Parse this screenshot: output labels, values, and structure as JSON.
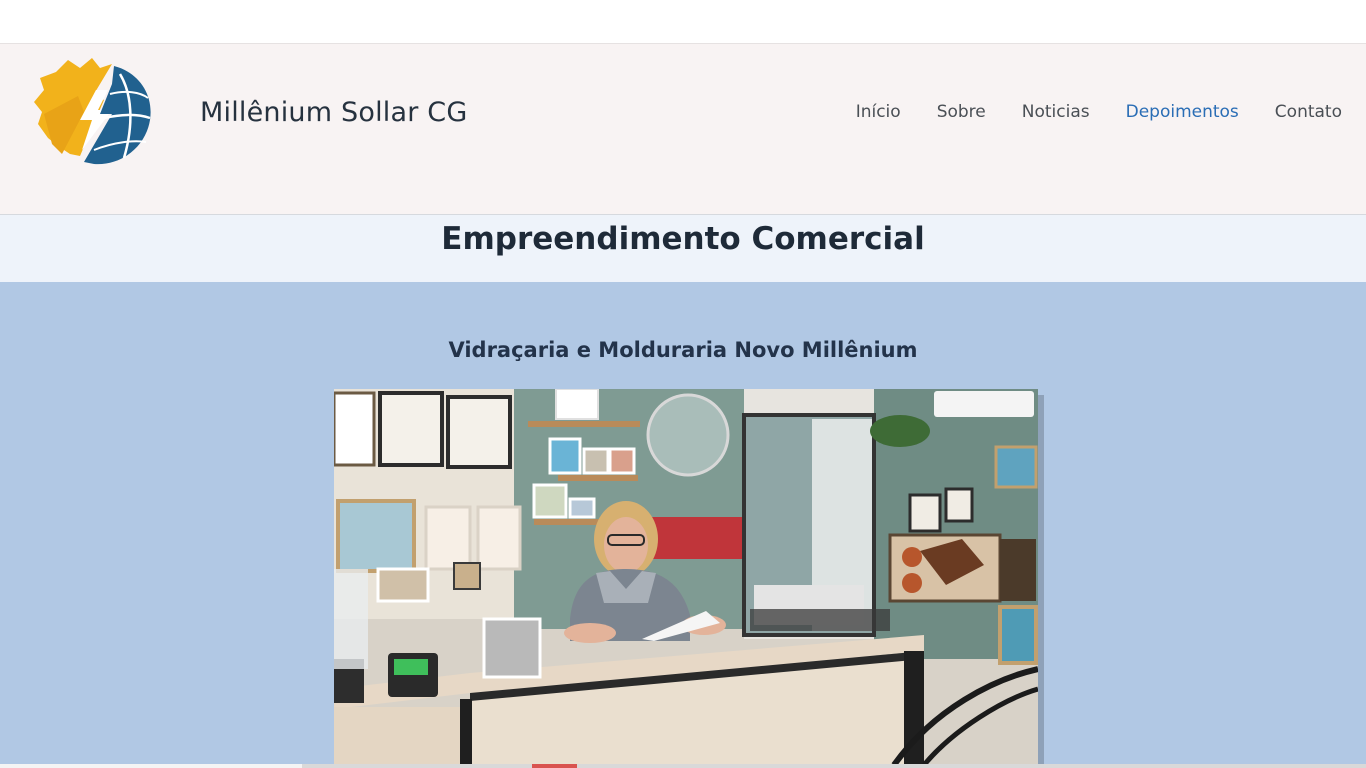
{
  "site": {
    "brand_name": "Millênium Sollar CG"
  },
  "nav": {
    "items": [
      {
        "label": "Início",
        "active": false
      },
      {
        "label": "Sobre",
        "active": false
      },
      {
        "label": "Noticias",
        "active": false
      },
      {
        "label": "Depoimentos",
        "active": true
      },
      {
        "label": "Contato",
        "active": false
      }
    ]
  },
  "section": {
    "title": "Empreendimento Comercial",
    "subtitle": "Vidraçaria e Molduraria Novo Millênium"
  },
  "colors": {
    "header_bg": "#f8f3f3",
    "content_bg": "#b1c8e4",
    "nav_active": "#2a6db5",
    "logo_yellow": "#f2b21b",
    "logo_blue": "#21618f"
  }
}
